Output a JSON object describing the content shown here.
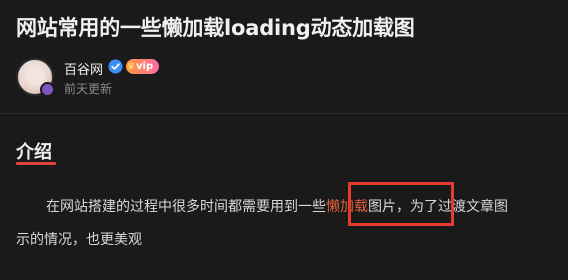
{
  "article": {
    "title": "网站常用的一些懒加载loading动态加载图"
  },
  "author": {
    "name": "百谷网",
    "vip_label": "vip",
    "post_time": "前天更新"
  },
  "section": {
    "heading": "介绍"
  },
  "paragraph": {
    "line1_before": "在网站搭建的过程中很多时间都需要用到一些",
    "highlight": "懒加载",
    "line1_after": "图片，为了过渡文章图",
    "line2": "示的情况，也更美观"
  },
  "colors": {
    "background": "#1a1a1b",
    "accent_red": "#e0423a",
    "highlight_text": "#e0603a",
    "verified_blue": "#3a8ef6"
  },
  "icons": {
    "verified": "verified-check-icon",
    "vip": "vip-badge-icon"
  }
}
